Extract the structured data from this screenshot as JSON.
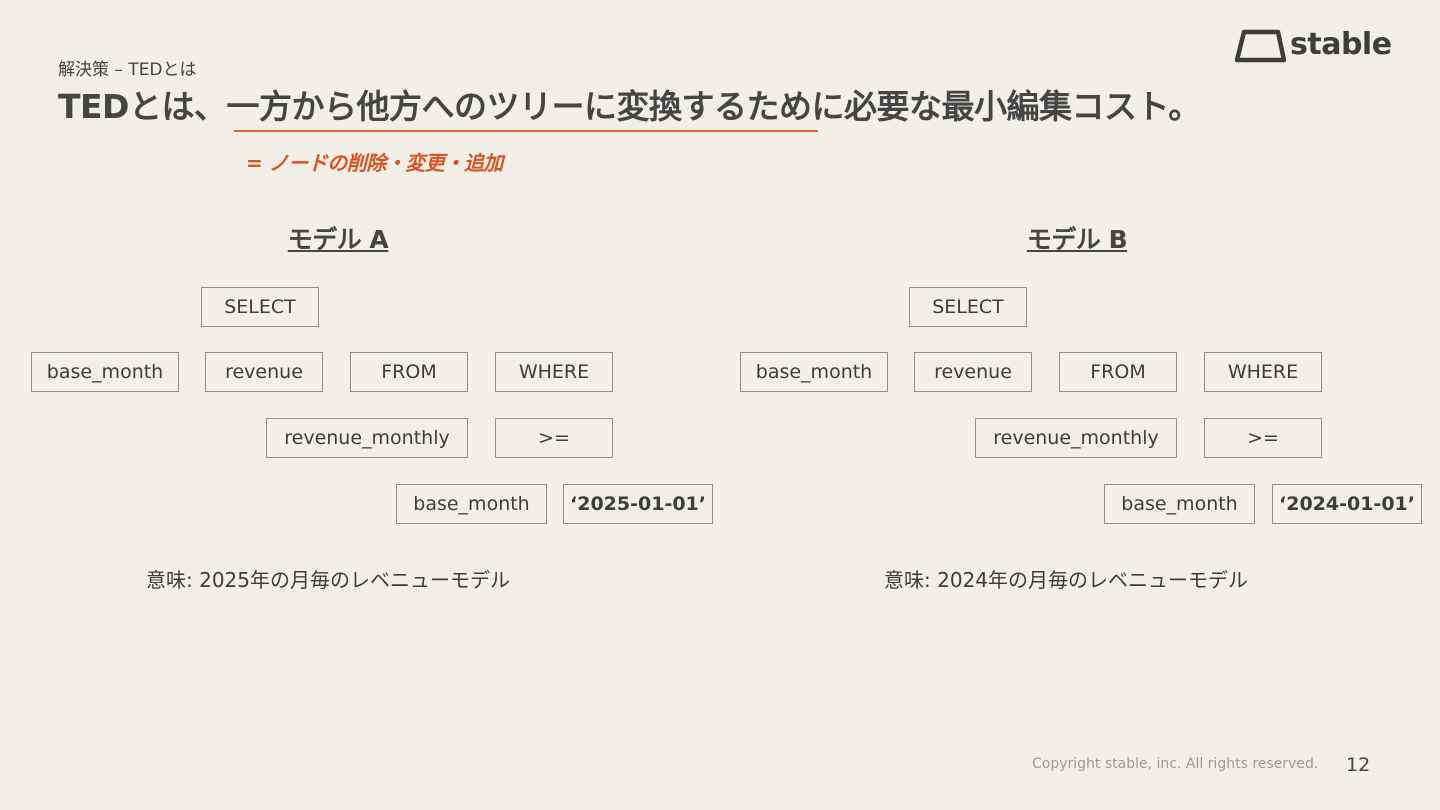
{
  "header": {
    "breadcrumb": "解決策 – TEDとは",
    "headline": "TEDとは、一方から他方へのツリーに変換するために必要な最小編集コスト。",
    "subnote": "= ノードの削除・変更・追加"
  },
  "logo": {
    "text": "stable",
    "icon": "trapezoid-logo-icon"
  },
  "models": [
    {
      "title": "モデル A",
      "nodes": {
        "select": "SELECT",
        "base_month": "base_month",
        "revenue": "revenue",
        "from": "FROM",
        "where": "WHERE",
        "revenue_monthly": "revenue_monthly",
        "gte": ">=",
        "base_month2": "base_month",
        "literal": "‘2025-01-01’"
      },
      "meaning": "意味: 2025年の月毎のレベニューモデル"
    },
    {
      "title": "モデル B",
      "nodes": {
        "select": "SELECT",
        "base_month": "base_month",
        "revenue": "revenue",
        "from": "FROM",
        "where": "WHERE",
        "revenue_monthly": "revenue_monthly",
        "gte": ">=",
        "base_month2": "base_month",
        "literal": "‘2024-01-01’"
      },
      "meaning": "意味: 2024年の月毎のレベニューモデル"
    }
  ],
  "footer": {
    "copyright": "Copyright stable, inc. All rights reserved.",
    "page": "12"
  },
  "colors": {
    "accent": "#e0642f",
    "background": "#f2efe9",
    "text": "#454545",
    "border": "#8e8e8e"
  }
}
